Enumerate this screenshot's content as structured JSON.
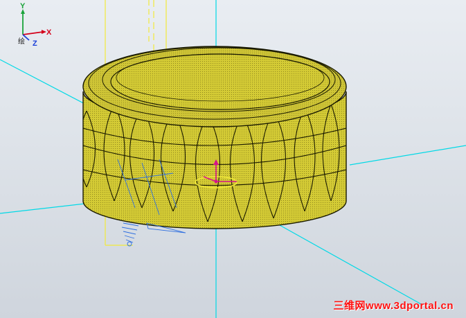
{
  "viewport": {
    "triad": {
      "y_label": "Y",
      "x_label": "X",
      "z_label": "Z",
      "prefix_label": "绘"
    }
  },
  "colors": {
    "background": "#dfe4ea",
    "part_fill": "#d4cb35",
    "part_edge": "#1a1a00",
    "axis_line": "#00d9e6",
    "construction_line": "#f2ea3a",
    "sketch_blue": "#2d6ee0",
    "origin_magenta": "#d6138c",
    "watermark": "#ff1010"
  },
  "watermark": {
    "text": "三维网www.3dportal.cn"
  }
}
